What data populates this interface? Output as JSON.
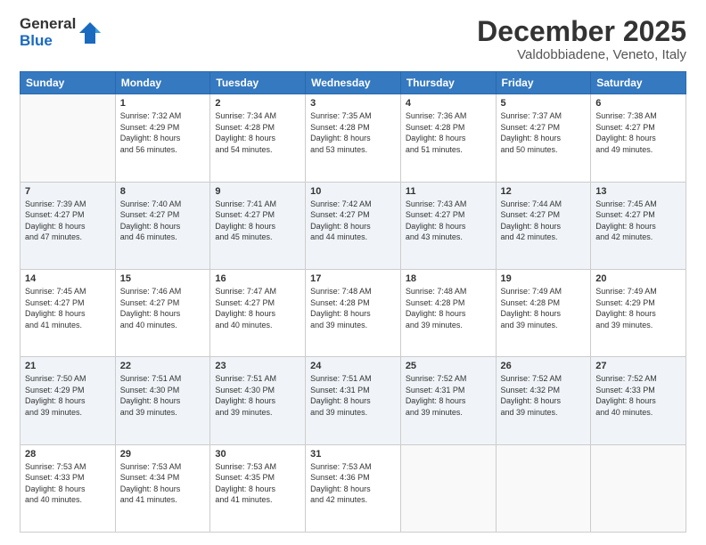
{
  "logo": {
    "general": "General",
    "blue": "Blue"
  },
  "title": "December 2025",
  "location": "Valdobbiadene, Veneto, Italy",
  "days_of_week": [
    "Sunday",
    "Monday",
    "Tuesday",
    "Wednesday",
    "Thursday",
    "Friday",
    "Saturday"
  ],
  "weeks": [
    [
      {
        "day": "",
        "info": "",
        "empty": true
      },
      {
        "day": "1",
        "info": "Sunrise: 7:32 AM\nSunset: 4:29 PM\nDaylight: 8 hours\nand 56 minutes."
      },
      {
        "day": "2",
        "info": "Sunrise: 7:34 AM\nSunset: 4:28 PM\nDaylight: 8 hours\nand 54 minutes."
      },
      {
        "day": "3",
        "info": "Sunrise: 7:35 AM\nSunset: 4:28 PM\nDaylight: 8 hours\nand 53 minutes."
      },
      {
        "day": "4",
        "info": "Sunrise: 7:36 AM\nSunset: 4:28 PM\nDaylight: 8 hours\nand 51 minutes."
      },
      {
        "day": "5",
        "info": "Sunrise: 7:37 AM\nSunset: 4:27 PM\nDaylight: 8 hours\nand 50 minutes."
      },
      {
        "day": "6",
        "info": "Sunrise: 7:38 AM\nSunset: 4:27 PM\nDaylight: 8 hours\nand 49 minutes."
      }
    ],
    [
      {
        "day": "7",
        "info": "Sunrise: 7:39 AM\nSunset: 4:27 PM\nDaylight: 8 hours\nand 47 minutes."
      },
      {
        "day": "8",
        "info": "Sunrise: 7:40 AM\nSunset: 4:27 PM\nDaylight: 8 hours\nand 46 minutes."
      },
      {
        "day": "9",
        "info": "Sunrise: 7:41 AM\nSunset: 4:27 PM\nDaylight: 8 hours\nand 45 minutes."
      },
      {
        "day": "10",
        "info": "Sunrise: 7:42 AM\nSunset: 4:27 PM\nDaylight: 8 hours\nand 44 minutes."
      },
      {
        "day": "11",
        "info": "Sunrise: 7:43 AM\nSunset: 4:27 PM\nDaylight: 8 hours\nand 43 minutes."
      },
      {
        "day": "12",
        "info": "Sunrise: 7:44 AM\nSunset: 4:27 PM\nDaylight: 8 hours\nand 42 minutes."
      },
      {
        "day": "13",
        "info": "Sunrise: 7:45 AM\nSunset: 4:27 PM\nDaylight: 8 hours\nand 42 minutes."
      }
    ],
    [
      {
        "day": "14",
        "info": "Sunrise: 7:45 AM\nSunset: 4:27 PM\nDaylight: 8 hours\nand 41 minutes."
      },
      {
        "day": "15",
        "info": "Sunrise: 7:46 AM\nSunset: 4:27 PM\nDaylight: 8 hours\nand 40 minutes."
      },
      {
        "day": "16",
        "info": "Sunrise: 7:47 AM\nSunset: 4:27 PM\nDaylight: 8 hours\nand 40 minutes."
      },
      {
        "day": "17",
        "info": "Sunrise: 7:48 AM\nSunset: 4:28 PM\nDaylight: 8 hours\nand 39 minutes."
      },
      {
        "day": "18",
        "info": "Sunrise: 7:48 AM\nSunset: 4:28 PM\nDaylight: 8 hours\nand 39 minutes."
      },
      {
        "day": "19",
        "info": "Sunrise: 7:49 AM\nSunset: 4:28 PM\nDaylight: 8 hours\nand 39 minutes."
      },
      {
        "day": "20",
        "info": "Sunrise: 7:49 AM\nSunset: 4:29 PM\nDaylight: 8 hours\nand 39 minutes."
      }
    ],
    [
      {
        "day": "21",
        "info": "Sunrise: 7:50 AM\nSunset: 4:29 PM\nDaylight: 8 hours\nand 39 minutes."
      },
      {
        "day": "22",
        "info": "Sunrise: 7:51 AM\nSunset: 4:30 PM\nDaylight: 8 hours\nand 39 minutes."
      },
      {
        "day": "23",
        "info": "Sunrise: 7:51 AM\nSunset: 4:30 PM\nDaylight: 8 hours\nand 39 minutes."
      },
      {
        "day": "24",
        "info": "Sunrise: 7:51 AM\nSunset: 4:31 PM\nDaylight: 8 hours\nand 39 minutes."
      },
      {
        "day": "25",
        "info": "Sunrise: 7:52 AM\nSunset: 4:31 PM\nDaylight: 8 hours\nand 39 minutes."
      },
      {
        "day": "26",
        "info": "Sunrise: 7:52 AM\nSunset: 4:32 PM\nDaylight: 8 hours\nand 39 minutes."
      },
      {
        "day": "27",
        "info": "Sunrise: 7:52 AM\nSunset: 4:33 PM\nDaylight: 8 hours\nand 40 minutes."
      }
    ],
    [
      {
        "day": "28",
        "info": "Sunrise: 7:53 AM\nSunset: 4:33 PM\nDaylight: 8 hours\nand 40 minutes."
      },
      {
        "day": "29",
        "info": "Sunrise: 7:53 AM\nSunset: 4:34 PM\nDaylight: 8 hours\nand 41 minutes."
      },
      {
        "day": "30",
        "info": "Sunrise: 7:53 AM\nSunset: 4:35 PM\nDaylight: 8 hours\nand 41 minutes."
      },
      {
        "day": "31",
        "info": "Sunrise: 7:53 AM\nSunset: 4:36 PM\nDaylight: 8 hours\nand 42 minutes."
      },
      {
        "day": "",
        "info": "",
        "empty": true
      },
      {
        "day": "",
        "info": "",
        "empty": true
      },
      {
        "day": "",
        "info": "",
        "empty": true
      }
    ]
  ]
}
